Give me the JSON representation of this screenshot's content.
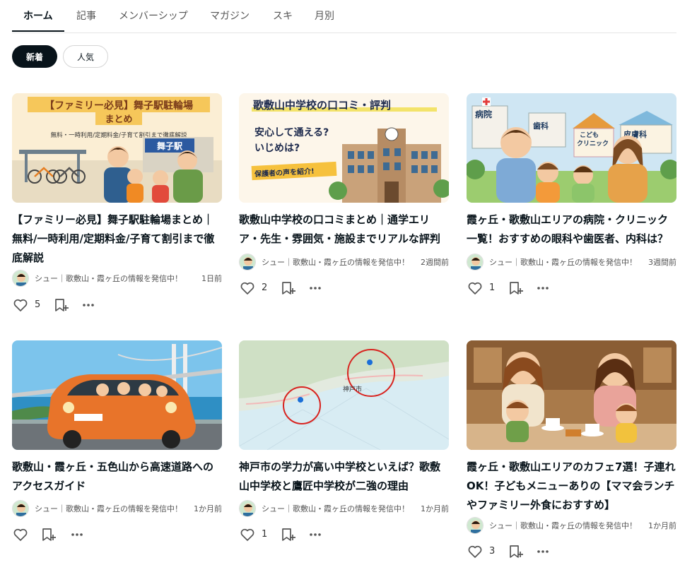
{
  "tabs": [
    {
      "label": "ホーム"
    },
    {
      "label": "記事"
    },
    {
      "label": "メンバーシップ"
    },
    {
      "label": "マガジン"
    },
    {
      "label": "スキ"
    },
    {
      "label": "月別"
    }
  ],
  "filters": {
    "new": "新着",
    "popular": "人気"
  },
  "icons": {
    "like": "heart-icon",
    "magazine": "add-to-magazine-icon",
    "more": "more-horizontal-icon"
  },
  "colors": {
    "text": "#08131a",
    "active_filter_bg": "#08131a",
    "muted": "#555555"
  },
  "articles": [
    {
      "title": "【ファミリー必見】舞子駅駐輪場まとめ｜無料/一時利用/定期料金/子育て割引まで徹底解説",
      "author": "シュー｜歌敷山・霞ヶ丘の情報を発信中！",
      "date": "1日前",
      "likes": "5",
      "thumb": {
        "headline": "【ファミリー必見】舞子駅駐輪場",
        "headline2": "まとめ",
        "sub": "無料・一時利用/定期料金/子育て割引まで徹底解説",
        "sign": "舞子駅"
      }
    },
    {
      "title": "歌敷山中学校の口コミまとめ｜通学エリア・先生・雰囲気・施設までリアルな評判",
      "author": "シュー｜歌敷山・霞ヶ丘の情報を発信中！",
      "date": "2週間前",
      "likes": "2",
      "thumb": {
        "headline": "歌敷山中学校の口コミ・評判",
        "line1": "安心して通える?",
        "line2": "いじめは?",
        "badge": "保護者の声を紹介!"
      }
    },
    {
      "title": "霞ヶ丘・歌敷山エリアの病院・クリニック一覧！おすすめの眼科や歯医者、内科は？",
      "author": "シュー｜歌敷山・霞ヶ丘の情報を発信中！",
      "date": "3週間前",
      "likes": "1",
      "thumb": {
        "sign1": "病院",
        "sign2": "歯科",
        "sign3": "こども",
        "sign3b": "クリニック",
        "sign4": "皮膚科"
      }
    },
    {
      "title": "歌敷山・霞ヶ丘・五色山から高速道路へのアクセスガイド",
      "author": "シュー｜歌敷山・霞ヶ丘の情報を発信中！",
      "date": "1か月前",
      "likes": ""
    },
    {
      "title": "神戸市の学力が高い中学校といえば？歌敷山中学校と鷹匠中学校が二強の理由",
      "author": "シュー｜歌敷山・霞ヶ丘の情報を発信中！",
      "date": "1か月前",
      "likes": "1",
      "thumb": {
        "city": "神戸市"
      }
    },
    {
      "title": "霞ヶ丘・歌敷山エリアのカフェ7選！子連れOK！子どもメニューありの【ママ会ランチやファミリー外食におすすめ】",
      "author": "シュー｜歌敷山・霞ヶ丘の情報を発信中！",
      "date": "1か月前",
      "likes": "3"
    }
  ]
}
